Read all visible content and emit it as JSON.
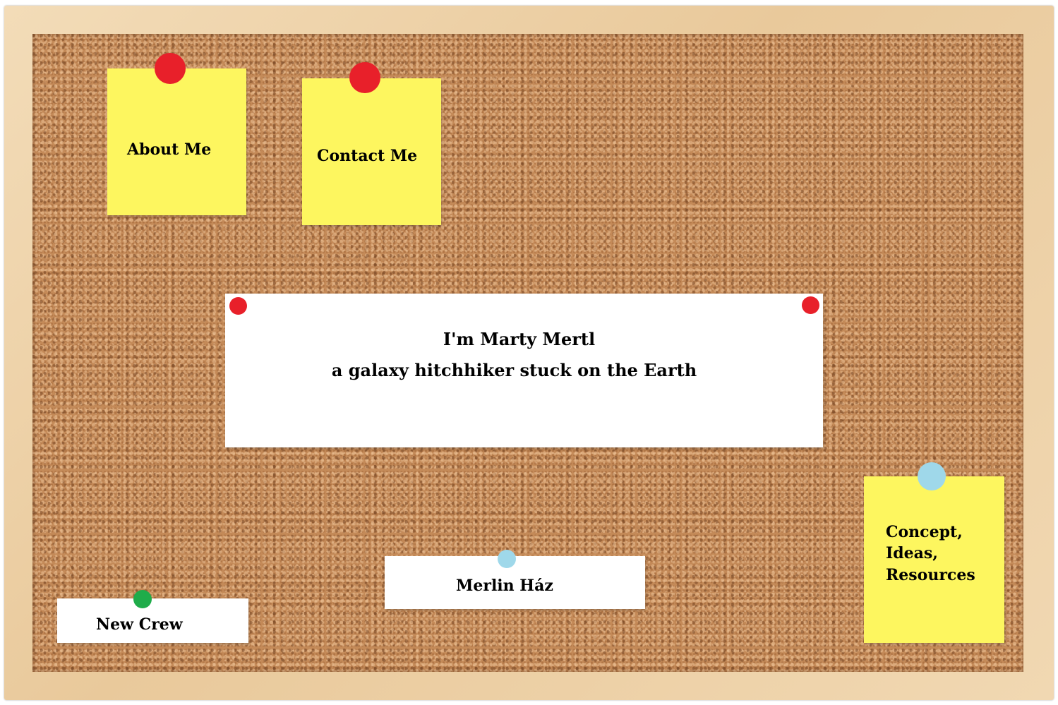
{
  "notes": {
    "about_me": "About Me",
    "contact_me": "Contact Me",
    "concept_line1": "Concept,",
    "concept_line2": "Ideas,",
    "concept_line3": "Resources",
    "merlin_haz": "Merlin Ház",
    "new_crew": "New Crew"
  },
  "banner": {
    "line1": "I'm Marty Mertl",
    "line2": "a galaxy hitchhiker stuck on the Earth"
  },
  "colors": {
    "sticky_yellow": "#fdf65f",
    "pin_red": "#e8202a",
    "pin_blue": "#9fd8ea",
    "pin_green": "#1fac4a",
    "cork": "#c48a58",
    "frame_wood": "#ecd0a6"
  }
}
